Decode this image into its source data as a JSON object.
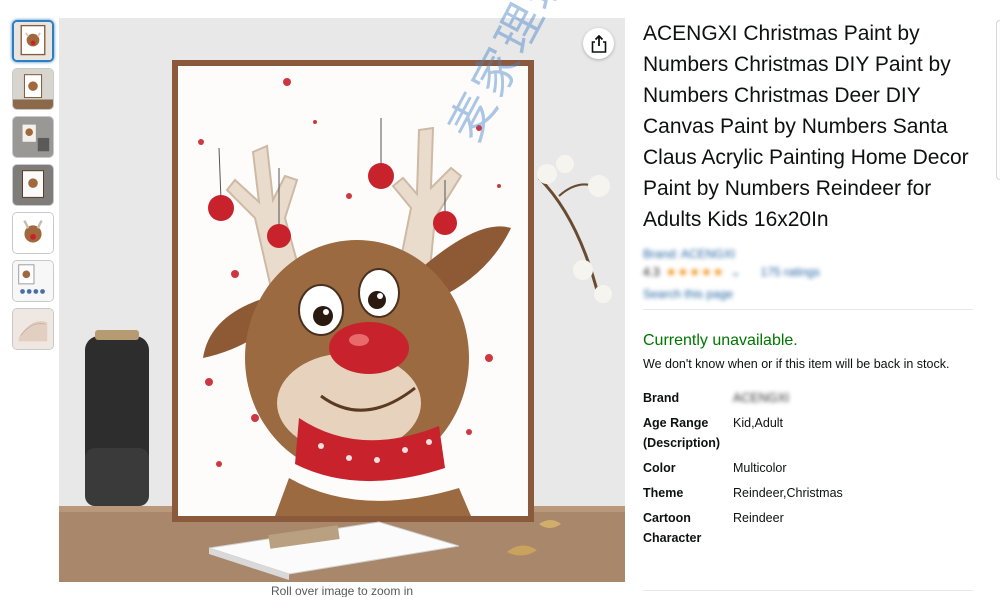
{
  "product": {
    "title": "ACENGXI Christmas Paint by Numbers Christmas DIY Paint by Numbers Christmas Deer DIY Canvas Paint by Numbers Santa Claus Acrylic Painting Home Decor Paint by Numbers Reindeer for Adults Kids 16x20In",
    "brand_link": "Brand: ACENGXI",
    "rating_value": "4.3",
    "rating_stars": "★★★★★",
    "ratings_count": "175 ratings",
    "search_link": "Search this page"
  },
  "availability": {
    "status": "Currently unavailable.",
    "note": "We don't know when or if this item will be back in stock."
  },
  "specs": [
    {
      "key": "Brand",
      "value": "ACENGXI"
    },
    {
      "key": "Age Range (Description)",
      "value": "Kid,Adult"
    },
    {
      "key": "Color",
      "value": "Multicolor"
    },
    {
      "key": "Theme",
      "value": "Reindeer,Christmas"
    },
    {
      "key": "Cartoon Character",
      "value": "Reindeer"
    }
  ],
  "image": {
    "zoom_hint": "Roll over image to zoom in",
    "thumbnail_count": 7,
    "selected_thumbnail": 1
  },
  "watermark_text": "麦家理玩",
  "icons": {
    "share": "share-icon"
  },
  "colors": {
    "availability_green": "#007600",
    "link_blue": "#2162a1",
    "star_orange": "#f08804",
    "thumb_selected": "#2f7ec0"
  }
}
